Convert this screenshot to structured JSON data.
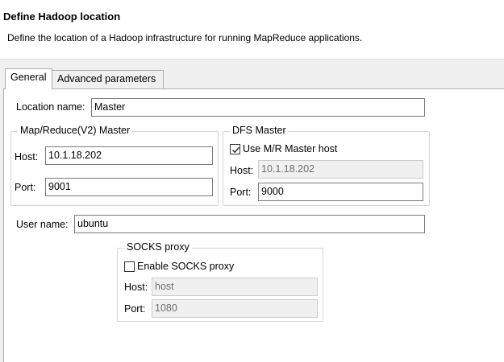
{
  "wizard": {
    "title": "Define Hadoop location",
    "description": "Define the location of a Hadoop infrastructure for running MapReduce applications."
  },
  "tabs": [
    {
      "label": "General",
      "selected": true
    },
    {
      "label": "Advanced parameters",
      "selected": false
    }
  ],
  "general": {
    "location_name_label": "Location name:",
    "location_name_value": "Master",
    "mr_master": {
      "title": "Map/Reduce(V2) Master",
      "host_label": "Host:",
      "host_value": "10.1.18.202",
      "port_label": "Port:",
      "port_value": "9001"
    },
    "dfs_master": {
      "title": "DFS Master",
      "use_mr_label": "Use M/R Master host",
      "use_mr_checked": true,
      "host_label": "Host:",
      "host_value": "10.1.18.202",
      "port_label": "Port:",
      "port_value": "9000"
    },
    "user_name_label": "User name:",
    "user_name_value": "ubuntu",
    "socks": {
      "title": "SOCKS proxy",
      "enable_label": "Enable SOCKS proxy",
      "enable_checked": false,
      "host_label": "Host:",
      "host_value": "host",
      "port_label": "Port:",
      "port_value": "1080"
    }
  },
  "icons": {
    "check": "check-icon"
  }
}
